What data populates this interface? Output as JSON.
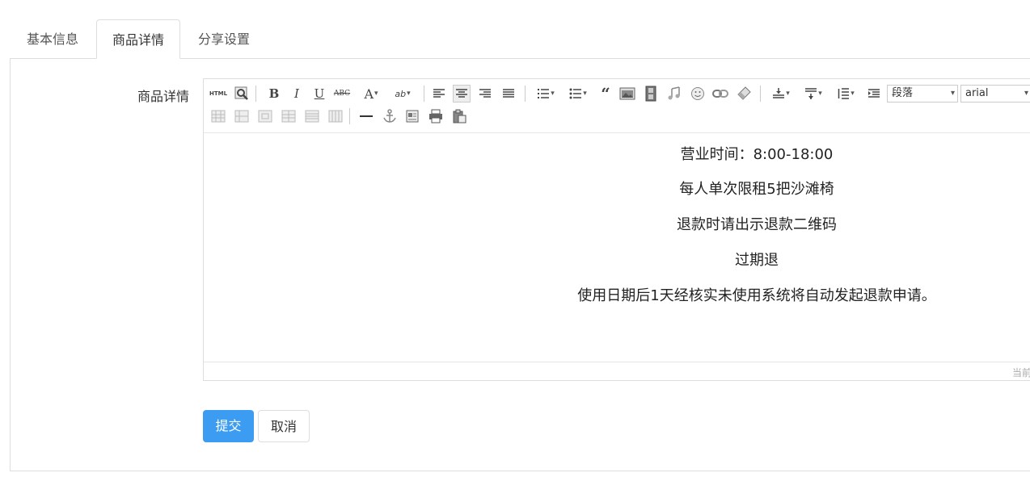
{
  "tabs": [
    {
      "label": "基本信息"
    },
    {
      "label": "商品详情"
    },
    {
      "label": "分享设置"
    }
  ],
  "form": {
    "detail_label": "商品详情",
    "submit_label": "提交",
    "cancel_label": "取消"
  },
  "editor": {
    "toolbar": {
      "html_label": "HTML",
      "bold_label": "B",
      "italic_label": "I",
      "underline_label": "U",
      "strike_label": "ABC",
      "fontcolor_label": "A",
      "backcolor_label": "ab",
      "paragraph_select": "段落",
      "font_select": "arial"
    },
    "content_lines": [
      "营业时间：8:00-18:00",
      "每人单次限租5把沙滩椅",
      "退款时请出示退款二维码",
      "过期退",
      "使用日期后1天经核实未使用系统将自动发起退款申请。"
    ],
    "status_text": "当前已输入"
  },
  "icons": {
    "preview": "search-preview-icon",
    "align_left": "align-left-icon",
    "align_center": "align-center-icon",
    "align_right": "align-right-icon",
    "justify": "justify-icon",
    "ordered_list": "ordered-list-icon",
    "unordered_list": "unordered-list-icon",
    "quote": "quote-icon",
    "image": "image-icon",
    "video": "video-icon",
    "music": "music-icon",
    "emotion": "emoji-icon",
    "link": "link-icon",
    "eraser": "eraser-icon",
    "anchor": "anchor-icon",
    "print": "print-icon",
    "paste": "paste-icon"
  },
  "colors": {
    "primary": "#3c9cf2",
    "border": "#dddddd"
  }
}
